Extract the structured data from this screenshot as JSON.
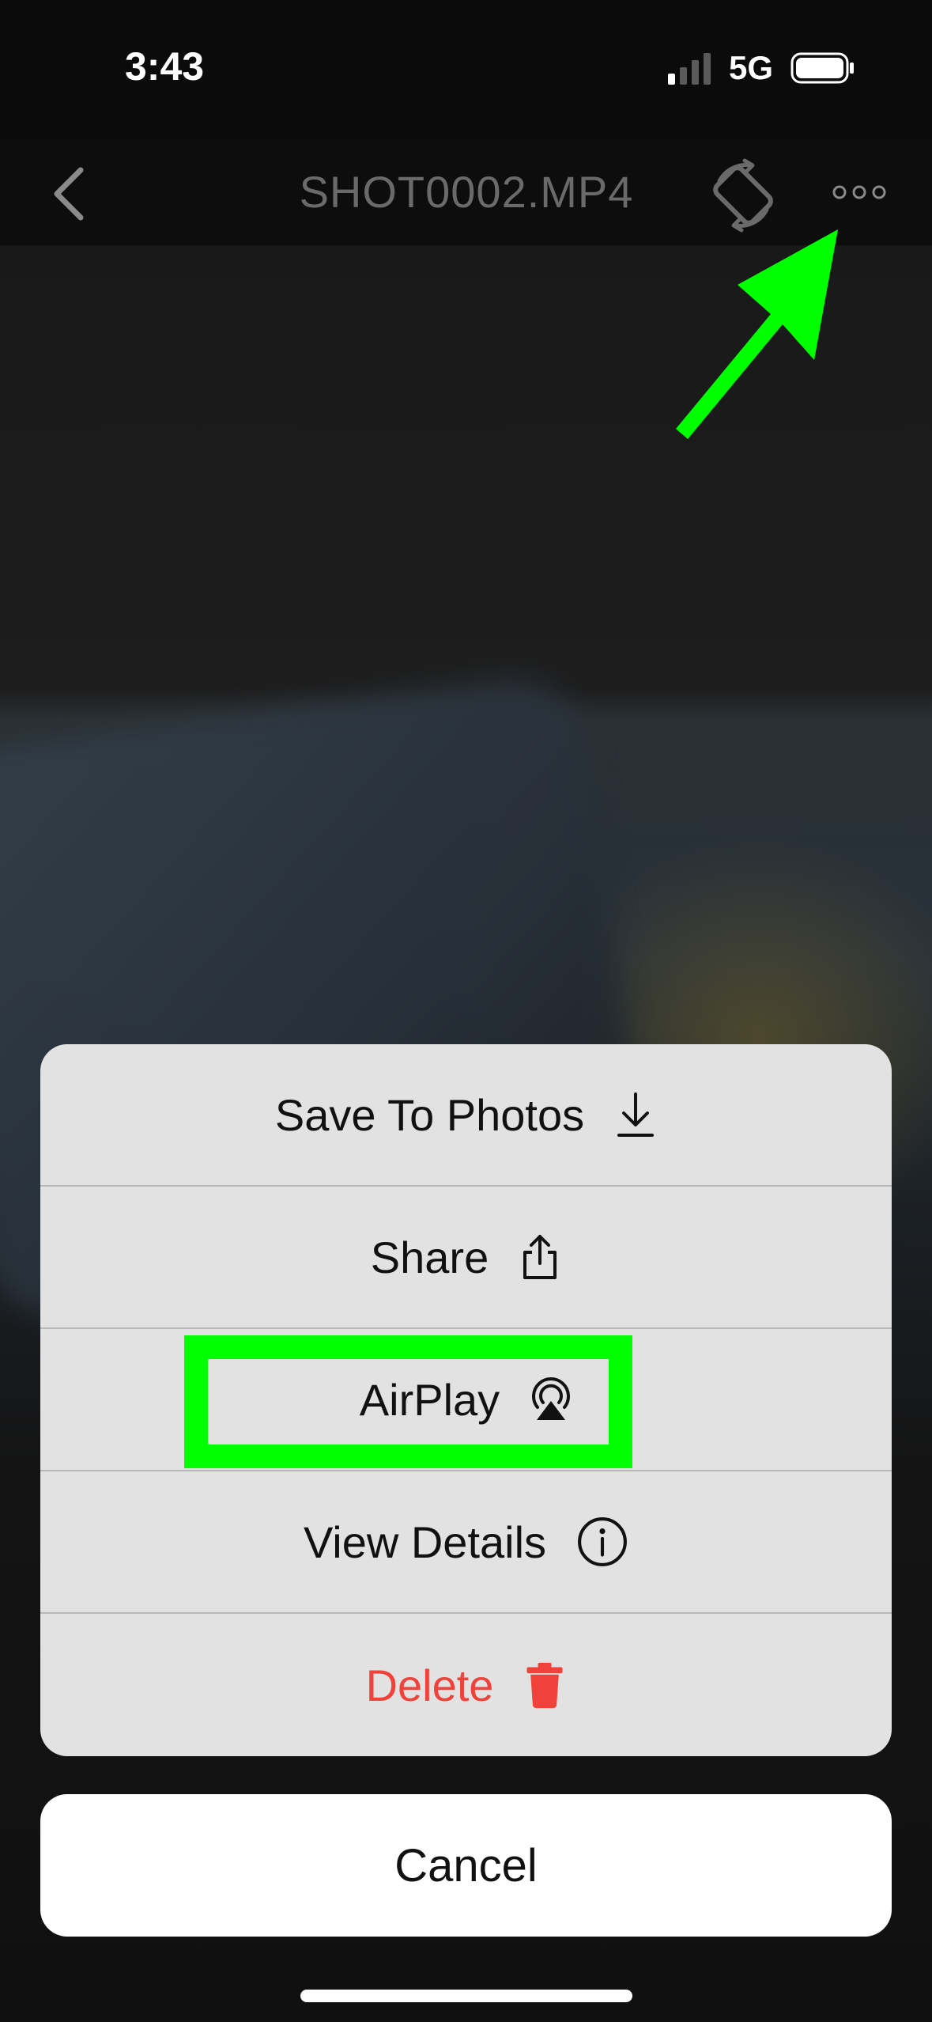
{
  "status_bar": {
    "time": "3:43",
    "network": "5G",
    "signal_icon": "cellular-signal-icon",
    "battery_icon": "battery-icon"
  },
  "nav_bar": {
    "title": "SHOT0002.MP4",
    "back_icon": "chevron-left-icon",
    "rotate_icon": "rotate-device-icon",
    "more_icon": "ellipsis-icon"
  },
  "action_sheet": {
    "items": [
      {
        "label": "Save To Photos",
        "icon": "download-icon"
      },
      {
        "label": "Share",
        "icon": "share-icon"
      },
      {
        "label": "AirPlay",
        "icon": "airplay-icon"
      },
      {
        "label": "View Details",
        "icon": "info-icon"
      },
      {
        "label": "Delete",
        "icon": "trash-icon"
      }
    ],
    "cancel_label": "Cancel"
  },
  "colors": {
    "annotation_green": "#00ff00",
    "destructive_red": "#f0413a",
    "sheet_background": "#e2e2e2",
    "title_gray": "#6a6a6a"
  }
}
